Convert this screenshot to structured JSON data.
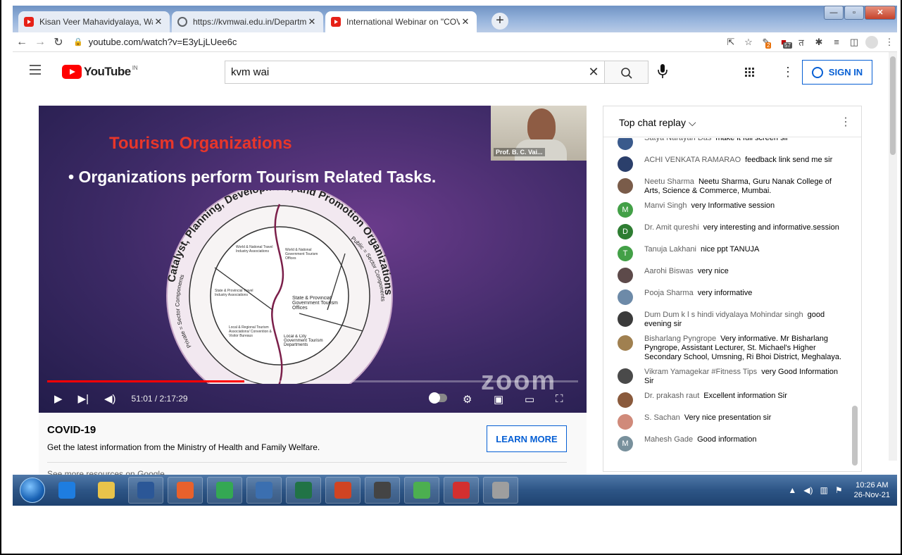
{
  "browser": {
    "tabs": [
      {
        "title": "Kisan Veer Mahavidyalaya, Wai",
        "favicon_color": "#e62117",
        "active": false
      },
      {
        "title": "https://kvmwai.edu.in/Departme",
        "favicon_color": "#5f6368",
        "active": false
      },
      {
        "title": "International Webinar on \"COVID",
        "favicon_color": "#e62117",
        "active": true
      }
    ],
    "new_tab": "+",
    "url": "youtube.com/watch?v=E3yLjLUee6c",
    "ext_badges": [
      "2",
      "57"
    ]
  },
  "youtube": {
    "logo_text": "YouTube",
    "country": "IN",
    "search_value": "kvm wai",
    "signin_label": "SIGN IN"
  },
  "video": {
    "slide_title": "Tourism Organizations",
    "slide_bullet": "• Organizations perform Tourism Related Tasks.",
    "speaker_name": "Prof. B. C. Vai...",
    "diagram": {
      "outer_ring": "Catalyst, Planning, Development, and Promotion Organizations",
      "left_arc": "Private = Sector Components",
      "right_arc": "Public = Sector Components",
      "cells": [
        "World & National Travel Industry Associations",
        "World & National Government Tourism Offices",
        "State & Provincial Travel Industry Associations",
        "State & Provincial Government Tourism Offices",
        "Local & Regional Tourism Associations/ Convention & Visitor Bureaus",
        "Local & City Government Tourism Departments"
      ]
    },
    "watermark": "zoom",
    "time": "51:01 / 2:17:29",
    "progress": 0.372
  },
  "covid": {
    "heading": "COVID-19",
    "description": "Get the latest information from the Ministry of Health and Family Welfare.",
    "button": "LEARN MORE",
    "more": "See more resources on Google"
  },
  "chat": {
    "header": "Top chat replay",
    "messages": [
      {
        "author": "Satya Narayan Das",
        "text": "make it full screen sir",
        "avatar_color": "#3a5a8c"
      },
      {
        "author": "ACHI VENKATA RAMARAO",
        "text": "feedback link send me sir",
        "avatar_color": "#2b3f6b"
      },
      {
        "author": "Neetu Sharma",
        "text": "Neetu Sharma, Guru Nanak College of Arts, Science & Commerce, Mumbai.",
        "avatar_color": "#7a5c4a"
      },
      {
        "author": "Manvi Singh",
        "text": "very Informative session",
        "avatar_color": "#43a047",
        "initial": "M"
      },
      {
        "author": "Dr. Amit qureshi",
        "text": "very interesting and informative.session",
        "avatar_color": "#2e7d32",
        "initial": "D"
      },
      {
        "author": "Tanuja Lakhani",
        "text": "nice ppt TANUJA",
        "avatar_color": "#43a047",
        "initial": "T"
      },
      {
        "author": "Aarohi Biswas",
        "text": "very nice",
        "avatar_color": "#5d4a4a"
      },
      {
        "author": "Pooja Sharma",
        "text": "very informative",
        "avatar_color": "#6d8aa8"
      },
      {
        "author": "Dum Dum k l s hindi vidyalaya Mohindar singh",
        "text": "good evening sir",
        "avatar_color": "#3b3b3b"
      },
      {
        "author": "Bisharlang Pyngrope",
        "text": "Very informative. Mr Bisharlang Pyngrope, Assistant Lecturer, St. Michael's Higher Secondary School, Umsning, Ri Bhoi District, Meghalaya.",
        "avatar_color": "#a08050"
      },
      {
        "author": "Vikram Yamagekar #Fitness Tips",
        "text": "very Good Information Sir",
        "avatar_color": "#4a4a4a"
      },
      {
        "author": "Dr. prakash raut",
        "text": "Excellent information Sir",
        "avatar_color": "#8a5a3c"
      },
      {
        "author": "S. Sachan",
        "text": "Very nice presentation sir",
        "avatar_color": "#d08a7a"
      },
      {
        "author": "Mahesh Gade",
        "text": "Good information",
        "avatar_color": "#78909c",
        "initial": "M"
      }
    ]
  },
  "taskbar": {
    "time": "10:26 AM",
    "date": "26-Nov-21",
    "app_colors": [
      "#1e7de0",
      "#e8c34a",
      "#2b5797",
      "#e8612c",
      "#34a853",
      "#3b6fb0",
      "#217346",
      "#d04423",
      "#444444",
      "#4caf50",
      "#d32f2f",
      "#9e9e9e"
    ]
  }
}
